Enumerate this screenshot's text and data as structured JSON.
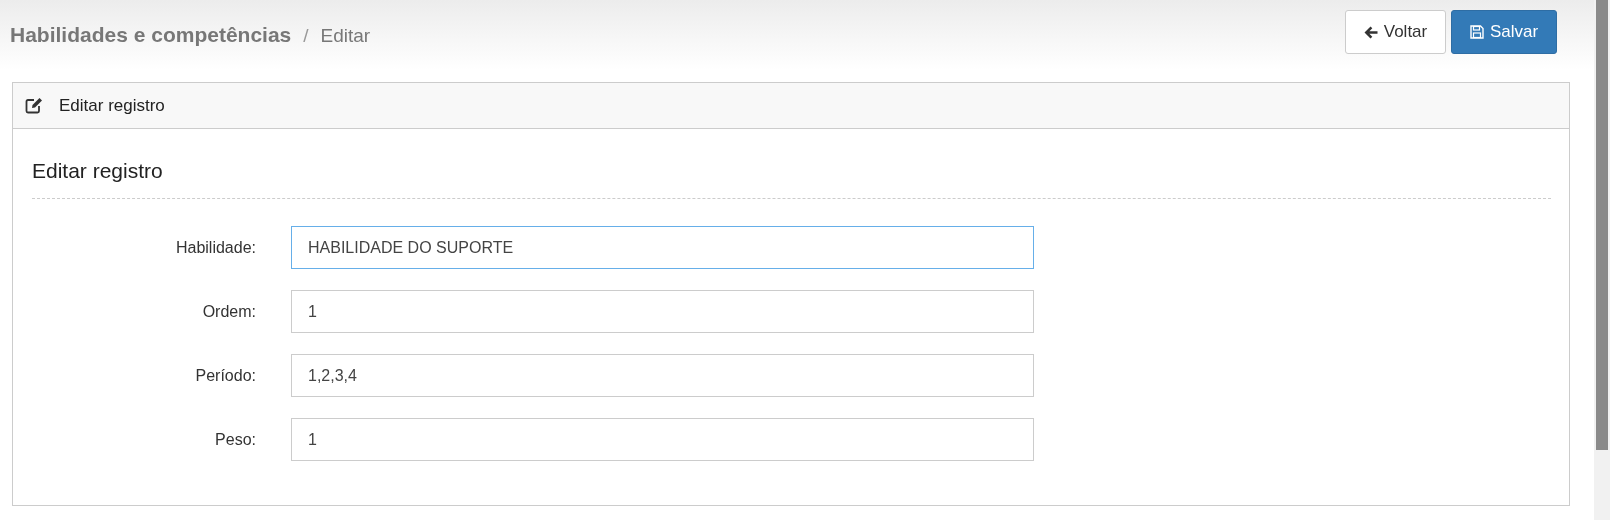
{
  "breadcrumb": {
    "title": "Habilidades e competências",
    "separator": "/",
    "current": "Editar"
  },
  "buttons": [
    {
      "kind": "back",
      "label": "Voltar"
    },
    {
      "kind": "save",
      "label": "Salvar"
    }
  ],
  "panel": {
    "title": "Editar registro",
    "section_title": "Editar registro",
    "fields": [
      {
        "label": "Habilidade:",
        "value": "HABILIDADE DO SUPORTE",
        "focused": true
      },
      {
        "label": "Ordem:",
        "value": "1",
        "focused": false
      },
      {
        "label": "Período:",
        "value": "1,2,3,4",
        "focused": false
      },
      {
        "label": "Peso:",
        "value": "1",
        "focused": false
      }
    ]
  }
}
